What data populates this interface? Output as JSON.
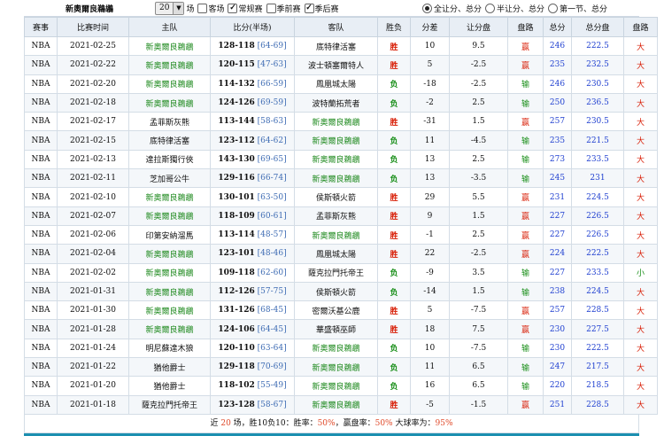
{
  "filter": {
    "team_name": "新奧爾良鵜鶘",
    "count_value": "20",
    "count_unit": "场",
    "options": [
      {
        "label": "客场",
        "checked": false
      },
      {
        "label": "常规赛",
        "checked": true
      },
      {
        "label": "季前赛",
        "checked": false
      },
      {
        "label": "季后赛",
        "checked": true
      }
    ],
    "radios": [
      {
        "label": "全让分、总分",
        "checked": true
      },
      {
        "label": "半让分、总分",
        "checked": false
      },
      {
        "label": "第一节、总分",
        "checked": false
      }
    ]
  },
  "table": {
    "headers": [
      "赛事",
      "比赛时间",
      "主队",
      "比分(半场)",
      "客队",
      "胜负",
      "分差",
      "让分盘",
      "盘路",
      "总分",
      "总分盘",
      "盘路"
    ],
    "rows": [
      {
        "league": "NBA",
        "date": "2021-02-25",
        "home": "新奧爾良鵜鶘",
        "score": "128-118",
        "half": "[64-69]",
        "away": "底特律活塞",
        "result": "胜",
        "diff": "10",
        "handicap": "9.5",
        "hc_result": "赢",
        "total": "246",
        "total_line": "222.5",
        "ou": "大",
        "home_hl": true,
        "away_hl": false
      },
      {
        "league": "NBA",
        "date": "2021-02-22",
        "home": "新奧爾良鵜鶘",
        "score": "120-115",
        "half": "[47-63]",
        "away": "波士頓塞爾特人",
        "result": "胜",
        "diff": "5",
        "handicap": "-2.5",
        "hc_result": "赢",
        "total": "235",
        "total_line": "232.5",
        "ou": "大",
        "home_hl": true,
        "away_hl": false
      },
      {
        "league": "NBA",
        "date": "2021-02-20",
        "home": "新奧爾良鵜鶘",
        "score": "114-132",
        "half": "[66-59]",
        "away": "鳳凰城太陽",
        "result": "负",
        "diff": "-18",
        "handicap": "-2.5",
        "hc_result": "输",
        "total": "246",
        "total_line": "230.5",
        "ou": "大",
        "home_hl": true,
        "away_hl": false
      },
      {
        "league": "NBA",
        "date": "2021-02-18",
        "home": "新奧爾良鵜鶘",
        "score": "124-126",
        "half": "[69-59]",
        "away": "波特蘭拓荒者",
        "result": "负",
        "diff": "-2",
        "handicap": "2.5",
        "hc_result": "输",
        "total": "250",
        "total_line": "236.5",
        "ou": "大",
        "home_hl": true,
        "away_hl": false
      },
      {
        "league": "NBA",
        "date": "2021-02-17",
        "home": "孟菲斯灰熊",
        "score": "113-144",
        "half": "[58-63]",
        "away": "新奧爾良鵜鶘",
        "result": "胜",
        "diff": "-31",
        "handicap": "1.5",
        "hc_result": "赢",
        "total": "257",
        "total_line": "230.5",
        "ou": "大",
        "home_hl": false,
        "away_hl": true
      },
      {
        "league": "NBA",
        "date": "2021-02-15",
        "home": "底特律活塞",
        "score": "123-112",
        "half": "[64-62]",
        "away": "新奧爾良鵜鶘",
        "result": "负",
        "diff": "11",
        "handicap": "-4.5",
        "hc_result": "输",
        "total": "235",
        "total_line": "221.5",
        "ou": "大",
        "home_hl": false,
        "away_hl": true
      },
      {
        "league": "NBA",
        "date": "2021-02-13",
        "home": "達拉斯獨行俠",
        "score": "143-130",
        "half": "[69-65]",
        "away": "新奧爾良鵜鶘",
        "result": "负",
        "diff": "13",
        "handicap": "2.5",
        "hc_result": "输",
        "total": "273",
        "total_line": "233.5",
        "ou": "大",
        "home_hl": false,
        "away_hl": true
      },
      {
        "league": "NBA",
        "date": "2021-02-11",
        "home": "芝加哥公牛",
        "score": "129-116",
        "half": "[66-74]",
        "away": "新奧爾良鵜鶘",
        "result": "负",
        "diff": "13",
        "handicap": "-3.5",
        "hc_result": "输",
        "total": "245",
        "total_line": "231",
        "ou": "大",
        "home_hl": false,
        "away_hl": true
      },
      {
        "league": "NBA",
        "date": "2021-02-10",
        "home": "新奧爾良鵜鶘",
        "score": "130-101",
        "half": "[63-50]",
        "away": "侯斯頓火箭",
        "result": "胜",
        "diff": "29",
        "handicap": "5.5",
        "hc_result": "赢",
        "total": "231",
        "total_line": "224.5",
        "ou": "大",
        "home_hl": true,
        "away_hl": false
      },
      {
        "league": "NBA",
        "date": "2021-02-07",
        "home": "新奧爾良鵜鶘",
        "score": "118-109",
        "half": "[60-61]",
        "away": "孟菲斯灰熊",
        "result": "胜",
        "diff": "9",
        "handicap": "1.5",
        "hc_result": "赢",
        "total": "227",
        "total_line": "226.5",
        "ou": "大",
        "home_hl": true,
        "away_hl": false
      },
      {
        "league": "NBA",
        "date": "2021-02-06",
        "home": "印第安納溜馬",
        "score": "113-114",
        "half": "[48-57]",
        "away": "新奧爾良鵜鶘",
        "result": "胜",
        "diff": "-1",
        "handicap": "2.5",
        "hc_result": "赢",
        "total": "227",
        "total_line": "226.5",
        "ou": "大",
        "home_hl": false,
        "away_hl": true
      },
      {
        "league": "NBA",
        "date": "2021-02-04",
        "home": "新奧爾良鵜鶘",
        "score": "123-101",
        "half": "[48-46]",
        "away": "鳳凰城太陽",
        "result": "胜",
        "diff": "22",
        "handicap": "-2.5",
        "hc_result": "赢",
        "total": "224",
        "total_line": "222.5",
        "ou": "大",
        "home_hl": true,
        "away_hl": false
      },
      {
        "league": "NBA",
        "date": "2021-02-02",
        "home": "新奧爾良鵜鶘",
        "score": "109-118",
        "half": "[62-60]",
        "away": "薩克拉門托帝王",
        "result": "负",
        "diff": "-9",
        "handicap": "3.5",
        "hc_result": "输",
        "total": "227",
        "total_line": "233.5",
        "ou": "小",
        "home_hl": true,
        "away_hl": false
      },
      {
        "league": "NBA",
        "date": "2021-01-31",
        "home": "新奧爾良鵜鶘",
        "score": "112-126",
        "half": "[57-75]",
        "away": "侯斯頓火箭",
        "result": "负",
        "diff": "-14",
        "handicap": "1.5",
        "hc_result": "输",
        "total": "238",
        "total_line": "224.5",
        "ou": "大",
        "home_hl": true,
        "away_hl": false
      },
      {
        "league": "NBA",
        "date": "2021-01-30",
        "home": "新奧爾良鵜鶘",
        "score": "131-126",
        "half": "[68-45]",
        "away": "密爾沃基公鹿",
        "result": "胜",
        "diff": "5",
        "handicap": "-7.5",
        "hc_result": "赢",
        "total": "257",
        "total_line": "228.5",
        "ou": "大",
        "home_hl": true,
        "away_hl": false
      },
      {
        "league": "NBA",
        "date": "2021-01-28",
        "home": "新奧爾良鵜鶘",
        "score": "124-106",
        "half": "[64-45]",
        "away": "華盛頓巫師",
        "result": "胜",
        "diff": "18",
        "handicap": "7.5",
        "hc_result": "赢",
        "total": "230",
        "total_line": "227.5",
        "ou": "大",
        "home_hl": true,
        "away_hl": false
      },
      {
        "league": "NBA",
        "date": "2021-01-24",
        "home": "明尼蘇達木狼",
        "score": "120-110",
        "half": "[63-64]",
        "away": "新奧爾良鵜鶘",
        "result": "负",
        "diff": "10",
        "handicap": "-7.5",
        "hc_result": "输",
        "total": "230",
        "total_line": "222.5",
        "ou": "大",
        "home_hl": false,
        "away_hl": true
      },
      {
        "league": "NBA",
        "date": "2021-01-22",
        "home": "猶他爵士",
        "score": "129-118",
        "half": "[70-69]",
        "away": "新奧爾良鵜鶘",
        "result": "负",
        "diff": "11",
        "handicap": "6.5",
        "hc_result": "输",
        "total": "247",
        "total_line": "217.5",
        "ou": "大",
        "home_hl": false,
        "away_hl": true
      },
      {
        "league": "NBA",
        "date": "2021-01-20",
        "home": "猶他爵士",
        "score": "118-102",
        "half": "[55-49]",
        "away": "新奧爾良鵜鶘",
        "result": "负",
        "diff": "16",
        "handicap": "6.5",
        "hc_result": "输",
        "total": "220",
        "total_line": "218.5",
        "ou": "大",
        "home_hl": false,
        "away_hl": true
      },
      {
        "league": "NBA",
        "date": "2021-01-18",
        "home": "薩克拉門托帝王",
        "score": "123-128",
        "half": "[58-67]",
        "away": "新奧爾良鵜鶘",
        "result": "胜",
        "diff": "-5",
        "handicap": "-1.5",
        "hc_result": "赢",
        "total": "251",
        "total_line": "228.5",
        "ou": "大",
        "home_hl": false,
        "away_hl": true
      }
    ]
  },
  "summary": {
    "p1": "近 ",
    "n_games": "20",
    "p2": " 场，胜10负10：胜率：",
    "win_rate": "50%",
    "p3": "，赢盘率：",
    "cover_rate": "50%",
    "p4": " 大球率为：",
    "over_rate": "95%"
  },
  "colors": {
    "win": "#d81e06",
    "lose": "#1a8f1a",
    "team_highlight": "#1f8a1f",
    "half_score": "#3d6bb3"
  }
}
